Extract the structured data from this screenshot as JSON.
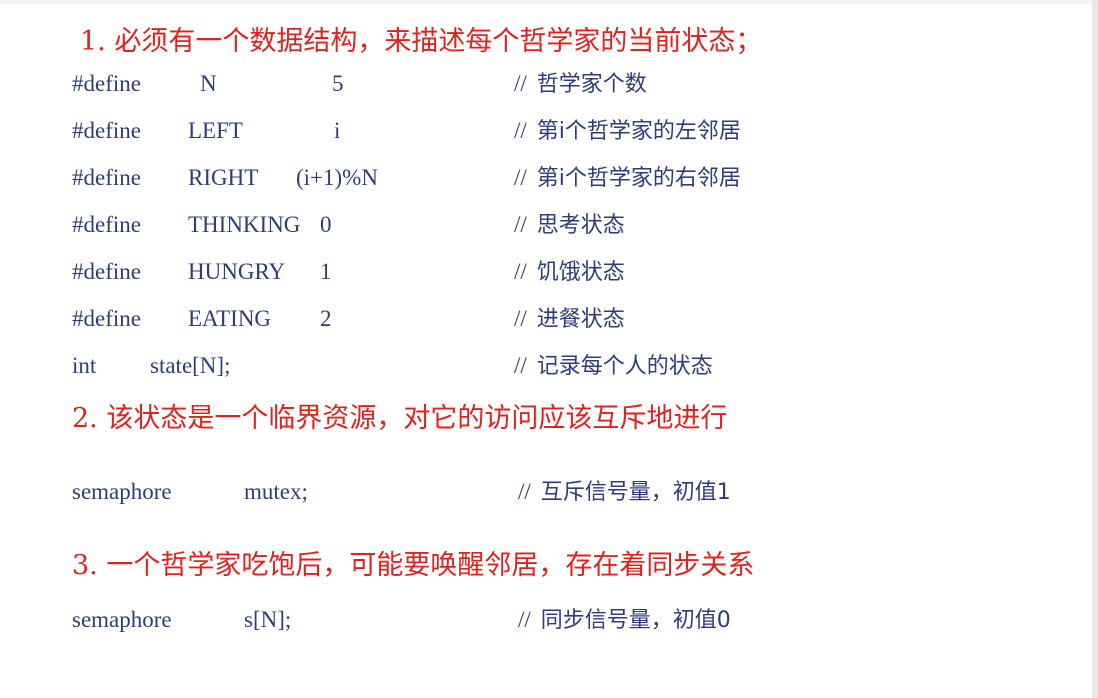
{
  "headings": {
    "h1": "1. 必须有一个数据结构，来描述每个哲学家的当前状态；",
    "h2": "2. 该状态是一个临界资源，对它的访问应该互斥地进行",
    "h3": "3.  一个哲学家吃饱后，可能要唤醒邻居，存在着同步关系"
  },
  "defines": [
    {
      "kw": "#define",
      "name": "N",
      "value": "5",
      "slash": "//",
      "comment": "哲学家个数"
    },
    {
      "kw": "#define",
      "name": "LEFT",
      "value": "i",
      "slash": "//",
      "comment": "第i个哲学家的左邻居"
    },
    {
      "kw": "#define",
      "name": "RIGHT",
      "value": "(i+1)%N",
      "slash": "//",
      "comment": "第i个哲学家的右邻居"
    },
    {
      "kw": "#define",
      "name": "THINKING",
      "value": "0",
      "slash": "//",
      "comment": "思考状态"
    },
    {
      "kw": "#define",
      "name": "HUNGRY",
      "value": "1",
      "slash": "//",
      "comment": "饥饿状态"
    },
    {
      "kw": "#define",
      "name": "EATING",
      "value": "2",
      "slash": "//",
      "comment": "进餐状态"
    }
  ],
  "state_decl": {
    "type": "int",
    "name": "state[N];",
    "slash": "//",
    "comment": "记录每个人的状态"
  },
  "mutex_decl": {
    "type": "semaphore",
    "name": "mutex;",
    "slash": "//",
    "comment": "互斥信号量，初值1"
  },
  "sync_decl": {
    "type": "semaphore",
    "name": "s[N];",
    "slash": "//",
    "comment": "同步信号量，初值0"
  }
}
